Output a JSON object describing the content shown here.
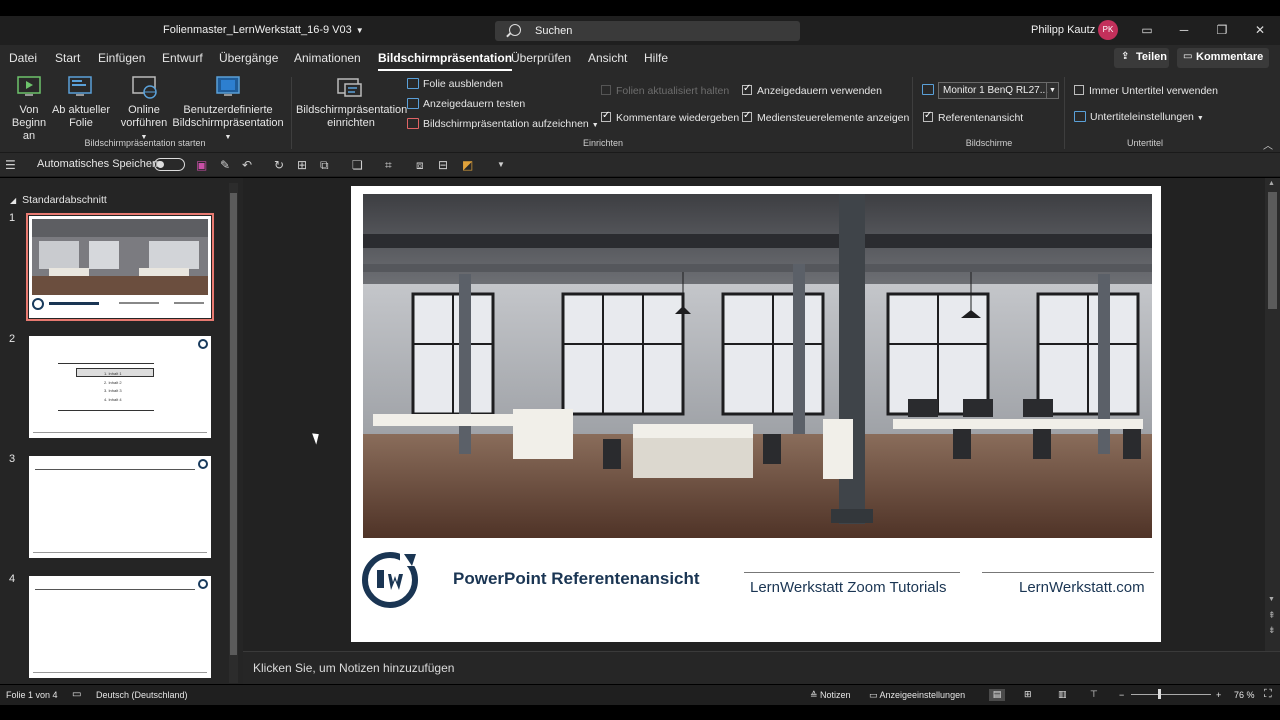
{
  "titlebar": {
    "document_name": "Folienmaster_LernWerkstatt_16-9 V03",
    "search_placeholder": "Suchen",
    "user_name": "Philipp Kautz",
    "user_initials": "PK",
    "avatar_color": "#c3305b"
  },
  "ribbon_tabs": [
    {
      "label": "Datei"
    },
    {
      "label": "Start"
    },
    {
      "label": "Einfügen"
    },
    {
      "label": "Entwurf"
    },
    {
      "label": "Übergänge"
    },
    {
      "label": "Animationen"
    },
    {
      "label": "Bildschirmpräsentation",
      "active": true
    },
    {
      "label": "Überprüfen"
    },
    {
      "label": "Ansicht"
    },
    {
      "label": "Hilfe"
    }
  ],
  "share_button": "Teilen",
  "comments_button": "Kommentare",
  "ribbon": {
    "start_group": {
      "von_beginn_line1": "Von",
      "von_beginn_line2": "Beginn an",
      "aktueller_line1": "Ab aktueller",
      "aktueller_line2": "Folie",
      "online_line1": "Online",
      "online_line2": "vorführen",
      "custom_line1": "Benutzerdefinierte",
      "custom_line2": "Bildschirmpräsentation",
      "group_label": "Bildschirmpräsentation starten"
    },
    "setup_group": {
      "einrichten_line1": "Bildschirmpräsentation",
      "einrichten_line2": "einrichten",
      "folie_ausblenden": "Folie ausblenden",
      "anzeigedauern_testen": "Anzeigedauern testen",
      "aufzeichnen": "Bildschirmpräsentation aufzeichnen",
      "folien_aktualisiert": "Folien aktualisiert halten",
      "kommentare": "Kommentare wiedergeben",
      "anzeigedauern_verwenden": "Anzeigedauern verwenden",
      "mediensteuerelemente": "Mediensteuerelemente anzeigen",
      "group_label": "Einrichten"
    },
    "monitors_group": {
      "monitor_value": "Monitor 1 BenQ RL27...",
      "referentenansicht": "Referentenansicht",
      "group_label": "Bildschirme"
    },
    "captions_group": {
      "immer_untertitel": "Immer Untertitel verwenden",
      "untertiteleinstellungen": "Untertiteleinstellungen",
      "group_label": "Untertitel"
    }
  },
  "qat": {
    "autosave_label": "Automatisches Speichern"
  },
  "slides_pane": {
    "section_name": "Standardabschnitt",
    "slides": [
      {
        "number": "1"
      },
      {
        "number": "2"
      },
      {
        "number": "3"
      },
      {
        "number": "4"
      }
    ],
    "slide2_items": [
      "1. Inhalt 1",
      "2. Inhalt 2",
      "3. Inhalt 3",
      "4. Inhalt 4"
    ]
  },
  "slide": {
    "title": "PowerPoint Referentenansicht",
    "tagline": "LernWerkstatt Zoom Tutorials",
    "website": "LernWerkstatt.com",
    "brand_color": "#1a3553"
  },
  "notes_placeholder": "Klicken Sie, um Notizen hinzuzufügen",
  "statusbar": {
    "slide_info": "Folie 1 von 4",
    "language": "Deutsch (Deutschland)",
    "notes_label": "Notizen",
    "display_settings": "Anzeigeeinstellungen",
    "zoom": "76 %"
  }
}
